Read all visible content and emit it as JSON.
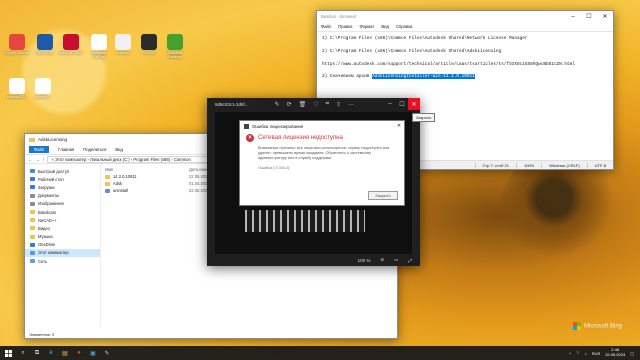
{
  "desktop": {
    "icons": [
      {
        "label": "Google Chrome",
        "color": "#e8453c"
      },
      {
        "label": "Revit 2021",
        "color": "#1f5aa6"
      },
      {
        "label": "AutoCAD 2021",
        "color": "#c8102e"
      },
      {
        "label": "Autodesk ReCap",
        "color": "#ffffff"
      },
      {
        "label": "uninstall",
        "color": "#f0f0f0"
      },
      {
        "label": "Civil 3D",
        "color": "#2b2b2b"
      },
      {
        "label": "Autodesk Desktop",
        "color": "#45a12c"
      },
      {
        "label": "autocadDT...",
        "color": "#ffffff"
      },
      {
        "label": "photo64...",
        "color": "#ffffff"
      }
    ],
    "watermark": "Microsoft Bing"
  },
  "notepad": {
    "title": "Безбол - Блокнот",
    "menu": [
      "Файл",
      "Правка",
      "Формат",
      "Вид",
      "Справка"
    ],
    "lines": [
      "1) C:\\Program Files (x86)\\Common Files\\Autodesk Shared\\Network License Manager",
      "2) C:\\Program Files (x86)\\Common Files\\Autodesk Shared\\AdskLicensing",
      "https://www.autodesk.com/support/technical/article/caas/tsarticles/ts/fSIX8c15S8hQwcBb81cZN.html"
    ],
    "line4_prefix": "3) Скачиваем архив ",
    "line4_selected": "AdskLicensingInstaller-win-14.2.0.10911",
    "status": [
      "Стр 7, стлб 21",
      "100%",
      "Windows (CRLF)",
      "UTF-8"
    ]
  },
  "explorer": {
    "title": "AdskLicensing",
    "ribbon": [
      "Файл",
      "Главная",
      "Поделиться",
      "Вид"
    ],
    "breadcrumb": "« Этот компьютер › Локальный диск (C:) › Program Files (x86) › Common",
    "nav": [
      {
        "label": "Быстрый доступ",
        "color": "#3b8ed8"
      },
      {
        "label": "Рабочий стол",
        "color": "#3a7bd5"
      },
      {
        "label": "Загрузки",
        "color": "#3a7bd5"
      },
      {
        "label": "Документы",
        "color": "#8c8c8c"
      },
      {
        "label": "Изображения",
        "color": "#8c8c8c"
      },
      {
        "label": "Bandicam",
        "color": "#f2c14e"
      },
      {
        "label": "NeCAD++",
        "color": "#f2c14e"
      },
      {
        "label": "Видео",
        "color": "#f2c14e"
      },
      {
        "label": "Музыка",
        "color": "#f2c14e"
      },
      {
        "label": "OneDrive",
        "color": "#2f7ed8"
      },
      {
        "label": "Этот компьютер",
        "color": "#5c9bd6"
      },
      {
        "label": "Сеть",
        "color": "#5c9bd6"
      }
    ],
    "columns": [
      "Имя",
      "Дата изменения"
    ],
    "files": [
      {
        "name": "14.2.0.10911",
        "date": "22.05.2024 2:44"
      },
      {
        "name": "Adsk",
        "date": "01.04.2024 5:16"
      },
      {
        "name": "uninstall",
        "date": "22.05.2024 2:40"
      }
    ],
    "status": "Элементов: 3"
  },
  "photo": {
    "title": "8d9c03c1-2d5f...",
    "zoom": "100 %",
    "tooltip": "Закрыть"
  },
  "error_dialog": {
    "title": "Ошибка лицензирования",
    "heading": "Сетевая лицензия недоступна",
    "message": "Возможные причины: все лицензии используются; сервер недоступен или удален; превышено время ожидания. Обратитесь к системному администратору или в службу поддержки.",
    "code": "Ошибка [-9.344.0]",
    "button": "Закрыть"
  },
  "taskbar": {
    "tray": "RUS",
    "time": "2:46",
    "date": "22.05.2024"
  }
}
